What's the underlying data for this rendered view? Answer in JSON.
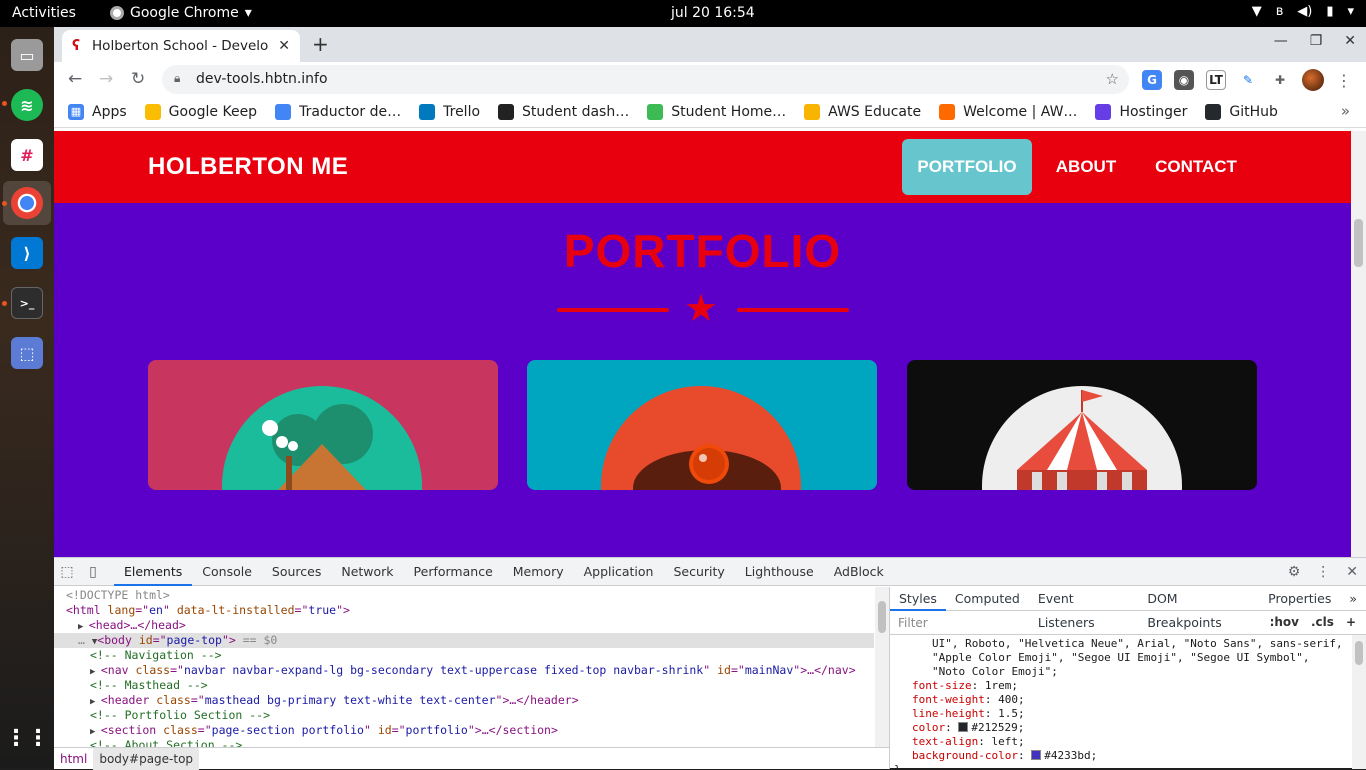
{
  "system": {
    "activities": "Activities",
    "app_name": "Google Chrome",
    "clock": "jul 20  16:54"
  },
  "browser": {
    "tab_title": "Holberton School - Develo",
    "url": "dev-tools.hbtn.info",
    "bookmarks": [
      {
        "label": "Apps",
        "color": "#4285f4"
      },
      {
        "label": "Google Keep",
        "color": "#fbbc04"
      },
      {
        "label": "Traductor de…",
        "color": "#4285f4"
      },
      {
        "label": "Trello",
        "color": "#0079bf"
      },
      {
        "label": "Student dash…",
        "color": "#222222"
      },
      {
        "label": "Student Home…",
        "color": "#3cba54"
      },
      {
        "label": "AWS Educate",
        "color": "#f8b400"
      },
      {
        "label": "Welcome | AW…",
        "color": "#ff6a00"
      },
      {
        "label": "Hostinger",
        "color": "#673de6"
      },
      {
        "label": "GitHub",
        "color": "#24292e"
      }
    ]
  },
  "site": {
    "brand": "HOLBERTON ME",
    "nav": {
      "portfolio": "PORTFOLIO",
      "about": "ABOUT",
      "contact": "CONTACT"
    },
    "section_title": "PORTFOLIO",
    "colors": {
      "nav_bg": "#e8000f",
      "page_bg": "#5a00c9",
      "active_link": "#66c5cd"
    }
  },
  "devtools": {
    "tabs": [
      "Elements",
      "Console",
      "Sources",
      "Network",
      "Performance",
      "Memory",
      "Application",
      "Security",
      "Lighthouse",
      "AdBlock"
    ],
    "active_tab": "Elements",
    "breadcrumbs": [
      "html",
      "body#page-top"
    ],
    "styles_tabs": [
      "Styles",
      "Computed",
      "Event Listeners",
      "DOM Breakpoints",
      "Properties"
    ],
    "filter_placeholder": "Filter",
    "hov": ":hov",
    "cls": ".cls",
    "dom_lines": [
      {
        "indent": 0,
        "kind": "doctype",
        "text": "<!DOCTYPE html>"
      },
      {
        "indent": 0,
        "kind": "open",
        "tag": "html",
        "attrs": [
          [
            "lang",
            "en"
          ],
          [
            "data-lt-installed",
            "true"
          ]
        ],
        "close": ">"
      },
      {
        "indent": 1,
        "kind": "collapsed",
        "tag": "head",
        "attrs": [],
        "tail": "…</head>"
      },
      {
        "indent": 1,
        "kind": "selected",
        "tag": "body",
        "attrs": [
          [
            "id",
            "page-top"
          ]
        ],
        "tail": " == $0"
      },
      {
        "indent": 2,
        "kind": "comment",
        "text": "<!-- Navigation -->"
      },
      {
        "indent": 2,
        "kind": "collapsed",
        "tag": "nav",
        "attrs": [
          [
            "class",
            "navbar navbar-expand-lg bg-secondary text-uppercase fixed-top navbar-shrink"
          ],
          [
            "id",
            "mainNav"
          ]
        ],
        "tail": "…</nav>"
      },
      {
        "indent": 2,
        "kind": "comment",
        "text": "<!-- Masthead -->"
      },
      {
        "indent": 2,
        "kind": "collapsed",
        "tag": "header",
        "attrs": [
          [
            "class",
            "masthead bg-primary text-white text-center"
          ]
        ],
        "tail": "…</header>"
      },
      {
        "indent": 2,
        "kind": "comment",
        "text": "<!-- Portfolio Section -->"
      },
      {
        "indent": 2,
        "kind": "collapsed",
        "tag": "section",
        "attrs": [
          [
            "class",
            "page-section portfolio"
          ],
          [
            "id",
            "portfolio"
          ]
        ],
        "tail": "…</section>"
      },
      {
        "indent": 2,
        "kind": "comment",
        "text": "<!-- About Section -->"
      }
    ],
    "css_lines": [
      {
        "text": "UI\", Roboto, \"Helvetica Neue\", Arial, \"Noto Sans\", sans-serif,",
        "cont": true
      },
      {
        "text": "\"Apple Color Emoji\", \"Segoe UI Emoji\", \"Segoe UI Symbol\",",
        "cont": true
      },
      {
        "text": "\"Noto Color Emoji\";",
        "cont": true
      },
      {
        "prop": "font-size",
        "value": "1rem;"
      },
      {
        "prop": "font-weight",
        "value": "400;"
      },
      {
        "prop": "line-height",
        "value": "1.5;"
      },
      {
        "prop": "color",
        "value": "#212529;",
        "swatch": "#212529"
      },
      {
        "prop": "text-align",
        "value": "left;"
      },
      {
        "prop": "background-color",
        "value": "#4233bd;",
        "swatch": "#4233bd"
      },
      {
        "text": "}",
        "brace": true
      }
    ]
  }
}
